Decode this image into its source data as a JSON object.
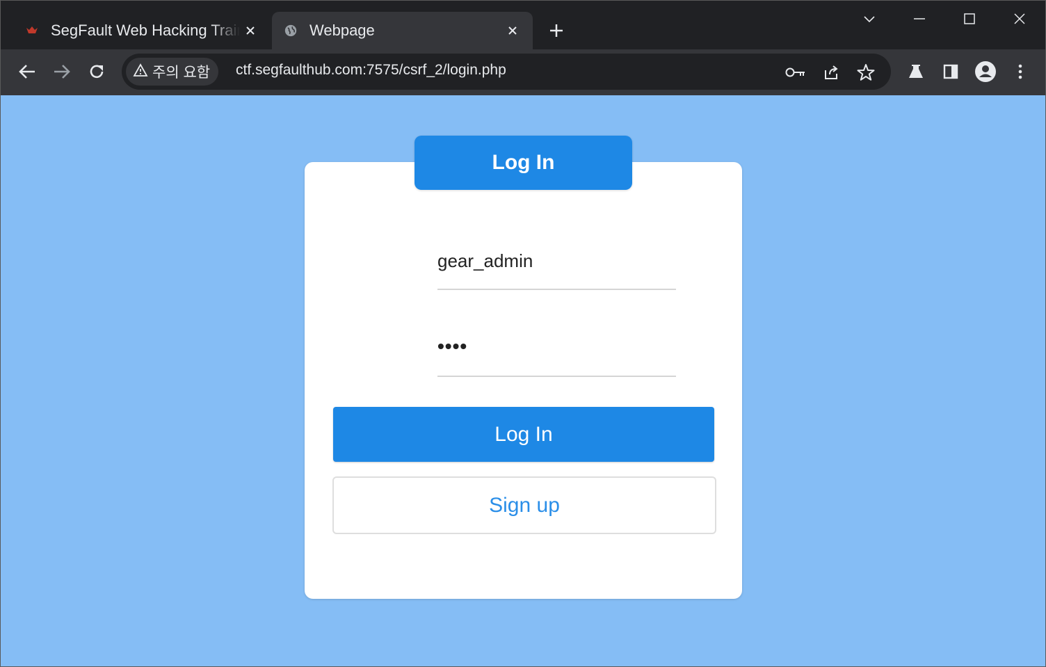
{
  "browser": {
    "tabs": [
      {
        "title": "SegFault Web Hacking Training",
        "favicon": "segfault-logo-icon",
        "active": false
      },
      {
        "title": "Webpage",
        "favicon": "globe-icon",
        "active": true
      }
    ],
    "security_chip": "주의 요함",
    "url": "ctf.segfaulthub.com:7575/csrf_2/login.php",
    "colors": {
      "frame": "#202124",
      "toolbar": "#35363a",
      "text": "#e8eaed"
    }
  },
  "page": {
    "background_color": "#85bdf5",
    "header_title": "Log In",
    "username_value": "gear_admin",
    "password_value": "••••",
    "login_button": "Log In",
    "signup_button": "Sign up",
    "accent_color": "#1e88e5"
  }
}
